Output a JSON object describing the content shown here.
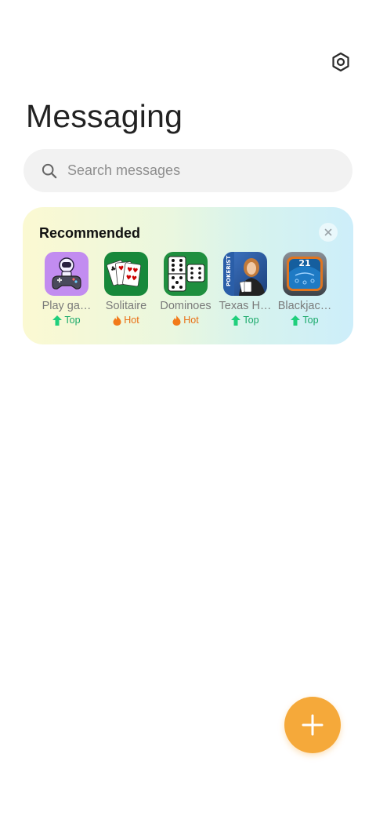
{
  "header": {
    "title": "Messaging",
    "settings_icon": "settings-hexagon-icon"
  },
  "search": {
    "placeholder": "Search messages",
    "icon": "search-icon"
  },
  "recommended": {
    "title": "Recommended",
    "close_icon": "close-icon",
    "apps": [
      {
        "name": "Play ga…",
        "badge": "Top",
        "badge_type": "top",
        "icon": "gamepad-astronaut-icon"
      },
      {
        "name": "Solitaire",
        "badge": "Hot",
        "badge_type": "hot",
        "icon": "solitaire-cards-icon"
      },
      {
        "name": "Dominoes",
        "badge": "Hot",
        "badge_type": "hot",
        "icon": "dominoes-icon"
      },
      {
        "name": "Texas H…",
        "badge": "Top",
        "badge_type": "top",
        "icon": "poker-texas-holdem-icon"
      },
      {
        "name": "Blackjac…",
        "badge": "Top",
        "badge_type": "top",
        "icon": "blackjack-21-icon"
      }
    ]
  },
  "fab": {
    "icon": "plus-icon"
  },
  "colors": {
    "accent": "#f5a93a",
    "top_badge": "#1aa96a",
    "hot_badge": "#e96f14",
    "search_bg": "#f2f2f2"
  }
}
